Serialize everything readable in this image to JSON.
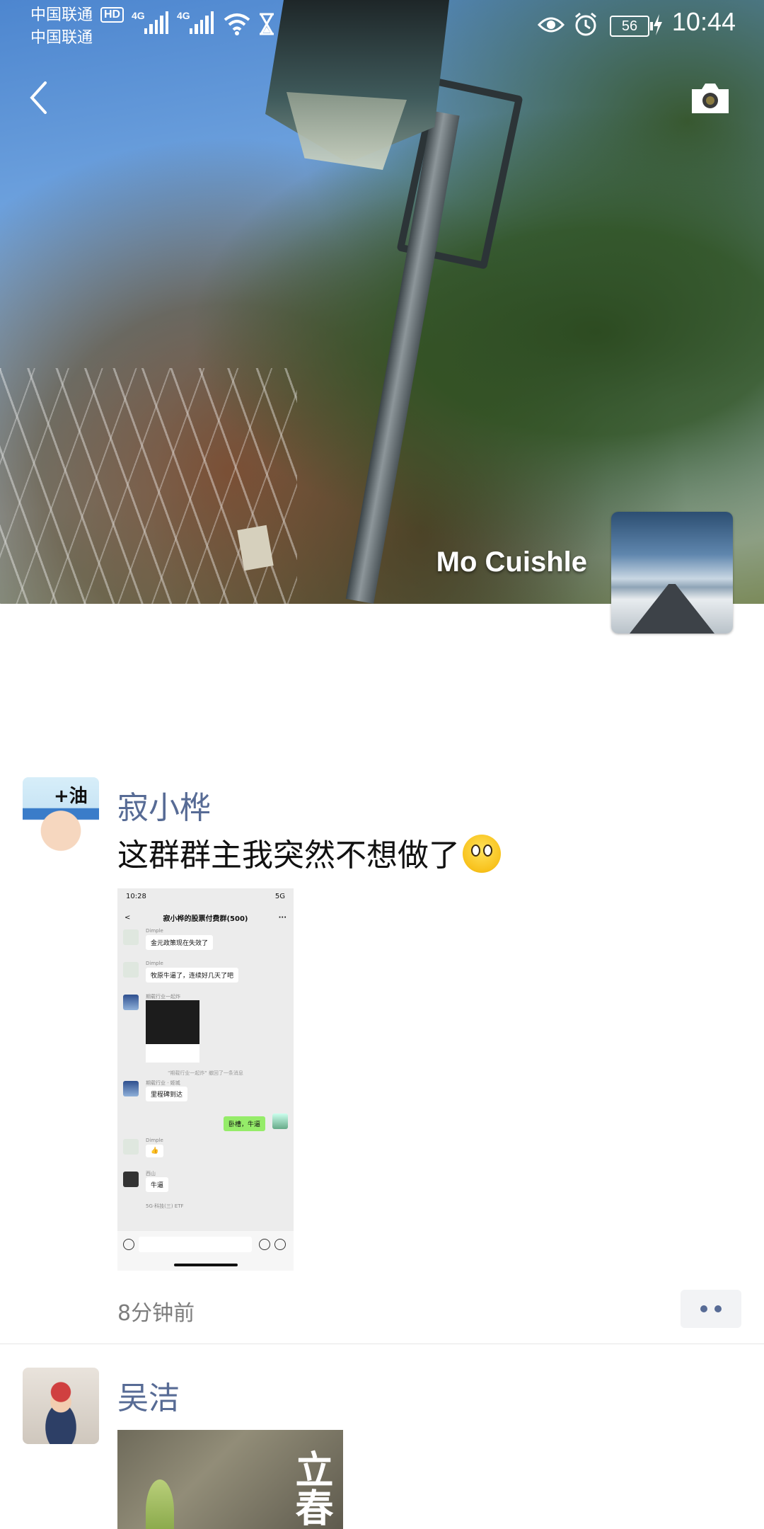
{
  "status_bar": {
    "carrier1": "中国联通",
    "hd_badge": "HD",
    "carrier2": "中国联通",
    "signal1": "4G",
    "signal2": "4G",
    "battery": "56",
    "time": "10:44"
  },
  "cover": {
    "profile_name": "Mo Cuishle"
  },
  "posts": [
    {
      "nickname": "寂小桦",
      "text": "这群群主我突然不想做了",
      "time_ago": "8分钟前",
      "screenshot": {
        "time": "10:28",
        "network": "5G",
        "title": "寂小桦的股票付费群(500)",
        "more": "···",
        "messages": [
          {
            "name": "Dimple",
            "text": "金元政策现在失效了"
          },
          {
            "name": "Dimple",
            "text": "牧原牛逼了，连续好几天了吧"
          },
          {
            "name": "期载行业一起炸"
          },
          {
            "system": "\"期载行业一起炸\" 撤回了一条消息"
          },
          {
            "name": "期载行业 · 姬城",
            "text": "里程碑到达"
          },
          {
            "self": "卧槽，牛逼"
          },
          {
            "name": "Dimple",
            "text": "👍"
          },
          {
            "name": "西山",
            "text": "牛逼"
          },
          {
            "name": "5G·科技(三) ETF"
          }
        ]
      }
    },
    {
      "nickname": "吴洁",
      "image_title": "立春"
    }
  ],
  "icons": {
    "back": "chevron-left-icon",
    "camera": "camera-icon",
    "more": "more-dots-icon"
  },
  "colors": {
    "nickname": "#576b95",
    "divider": "#e6e6e6"
  }
}
